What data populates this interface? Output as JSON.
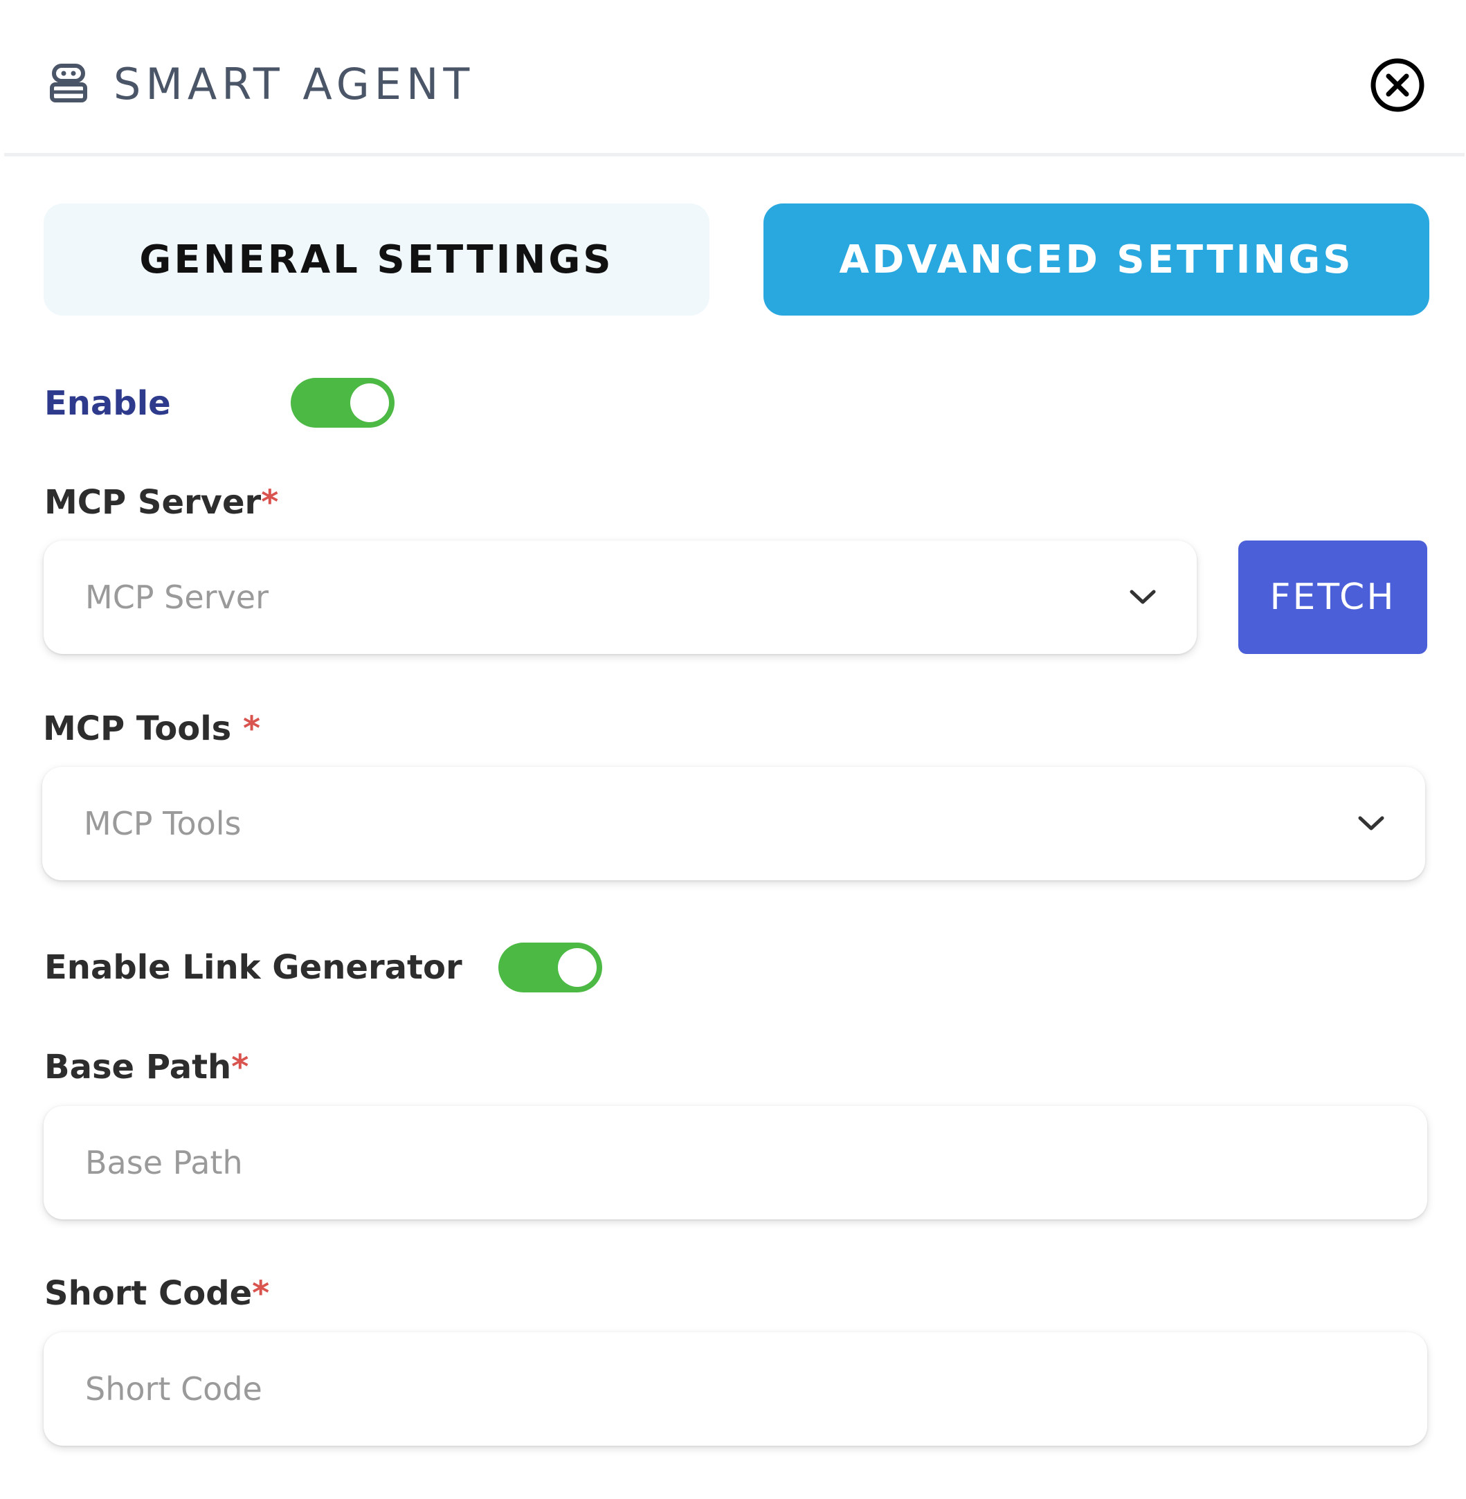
{
  "header": {
    "title": "SMART AGENT",
    "icon": "robot-icon",
    "close_icon": "close-circle-icon"
  },
  "tabs": [
    {
      "label": "GENERAL SETTINGS",
      "active": false
    },
    {
      "label": "ADVANCED SETTINGS",
      "active": true
    }
  ],
  "form": {
    "enable": {
      "label": "Enable",
      "on": true
    },
    "mcp_server": {
      "label": "MCP Server",
      "required_mark": "*",
      "placeholder": "MCP Server",
      "fetch_label": "FETCH"
    },
    "mcp_tools": {
      "label": "MCP Tools ",
      "required_mark": "*",
      "placeholder": "MCP Tools"
    },
    "link_generator": {
      "label": "Enable Link Generator",
      "on": true
    },
    "base_path": {
      "label": "Base Path",
      "required_mark": "*",
      "placeholder": "Base Path"
    },
    "short_code": {
      "label": "Short Code",
      "required_mark": "*",
      "placeholder": "Short Code"
    }
  },
  "colors": {
    "accent_tab": "#29a8e0",
    "fetch_button": "#4b5fd9",
    "toggle_on": "#4cb944",
    "required": "#d9534f",
    "enable_label": "#2e3b8c"
  }
}
